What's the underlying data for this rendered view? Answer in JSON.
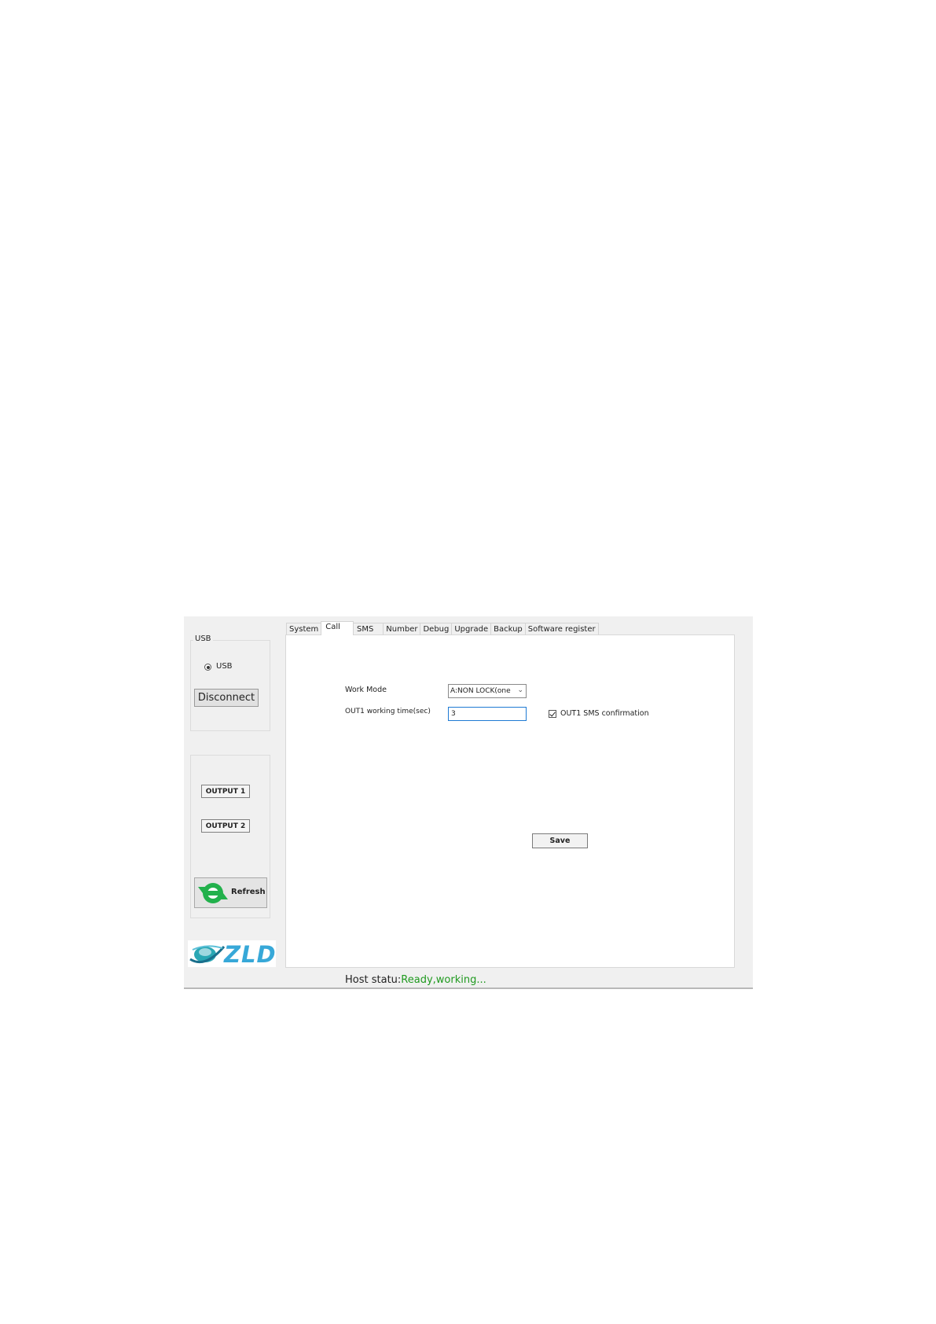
{
  "tabs": [
    "System",
    "Call",
    "SMS",
    "Number",
    "Debug",
    "Upgrade",
    "Backup",
    "Software register"
  ],
  "active_tab": "Call",
  "sidebar": {
    "usb_group_label": "USB",
    "usb_radio_label": "USB",
    "disconnect_label": "Disconnect",
    "output1_label": "OUTPUT 1",
    "output2_label": "OUTPUT 2",
    "refresh_label": "Refresh",
    "logo_text": "ZLD"
  },
  "call_panel": {
    "work_mode_label": "Work Mode",
    "work_mode_value": "A:NON LOCK(one",
    "out1_time_label": "OUT1 working time(sec)",
    "out1_time_value": "3",
    "sms_confirm_label": "OUT1 SMS confirmation",
    "save_label": "Save"
  },
  "status_bar": {
    "label": "Host statu:",
    "value": "Ready,working..."
  },
  "colors": {
    "status_ok": "#1f9a1f",
    "refresh_green": "#22b14c",
    "logo_teal": "#2aa7b4",
    "logo_text": "#37a8d8"
  }
}
